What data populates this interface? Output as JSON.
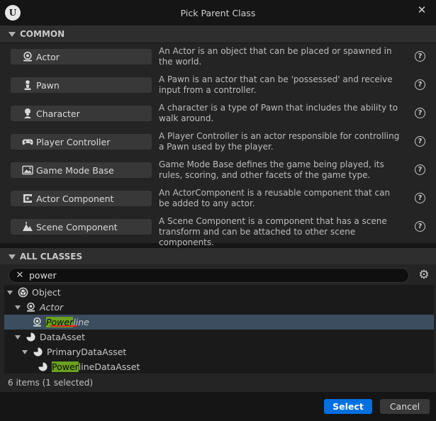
{
  "window": {
    "title": "Pick Parent Class"
  },
  "common": {
    "header": "COMMON",
    "items": [
      {
        "label": "Actor",
        "icon": "actor-icon",
        "description": "An Actor is an object that can be placed or spawned in the world."
      },
      {
        "label": "Pawn",
        "icon": "pawn-icon",
        "description": "A Pawn is an actor that can be 'possessed' and receive input from a controller."
      },
      {
        "label": "Character",
        "icon": "character-icon",
        "description": "A character is a type of Pawn that includes the ability to walk around."
      },
      {
        "label": "Player Controller",
        "icon": "gamepad-icon",
        "description": "A Player Controller is an actor responsible for controlling a Pawn used by the player."
      },
      {
        "label": "Game Mode Base",
        "icon": "game-mode-icon",
        "description": "Game Mode Base defines the game being played, its rules, scoring, and other facets of the game type."
      },
      {
        "label": "Actor Component",
        "icon": "actor-component-icon",
        "description": "An ActorComponent is a reusable component that can be added to any actor."
      },
      {
        "label": "Scene Component",
        "icon": "scene-component-icon",
        "description": "A Scene Component is a component that has a scene transform and can be attached to other scene components."
      }
    ],
    "help_glyph": "?"
  },
  "all_classes": {
    "header": "ALL CLASSES",
    "search_value": "power",
    "tree": {
      "object": "Object",
      "actor": "Actor",
      "powerline_match": "Power",
      "powerline_rest": "line",
      "dataasset": "DataAsset",
      "primarydataasset": "PrimaryDataAsset",
      "powerlinedataasset_match": "Power",
      "powerlinedataasset_rest": "lineDataAsset"
    },
    "status": "6 items (1 selected)"
  },
  "footer": {
    "select_label": "Select",
    "cancel_label": "Cancel"
  },
  "colors": {
    "accent": "#0070e0",
    "highlight": "#6aa11e",
    "selection": "#3b4d5e"
  }
}
